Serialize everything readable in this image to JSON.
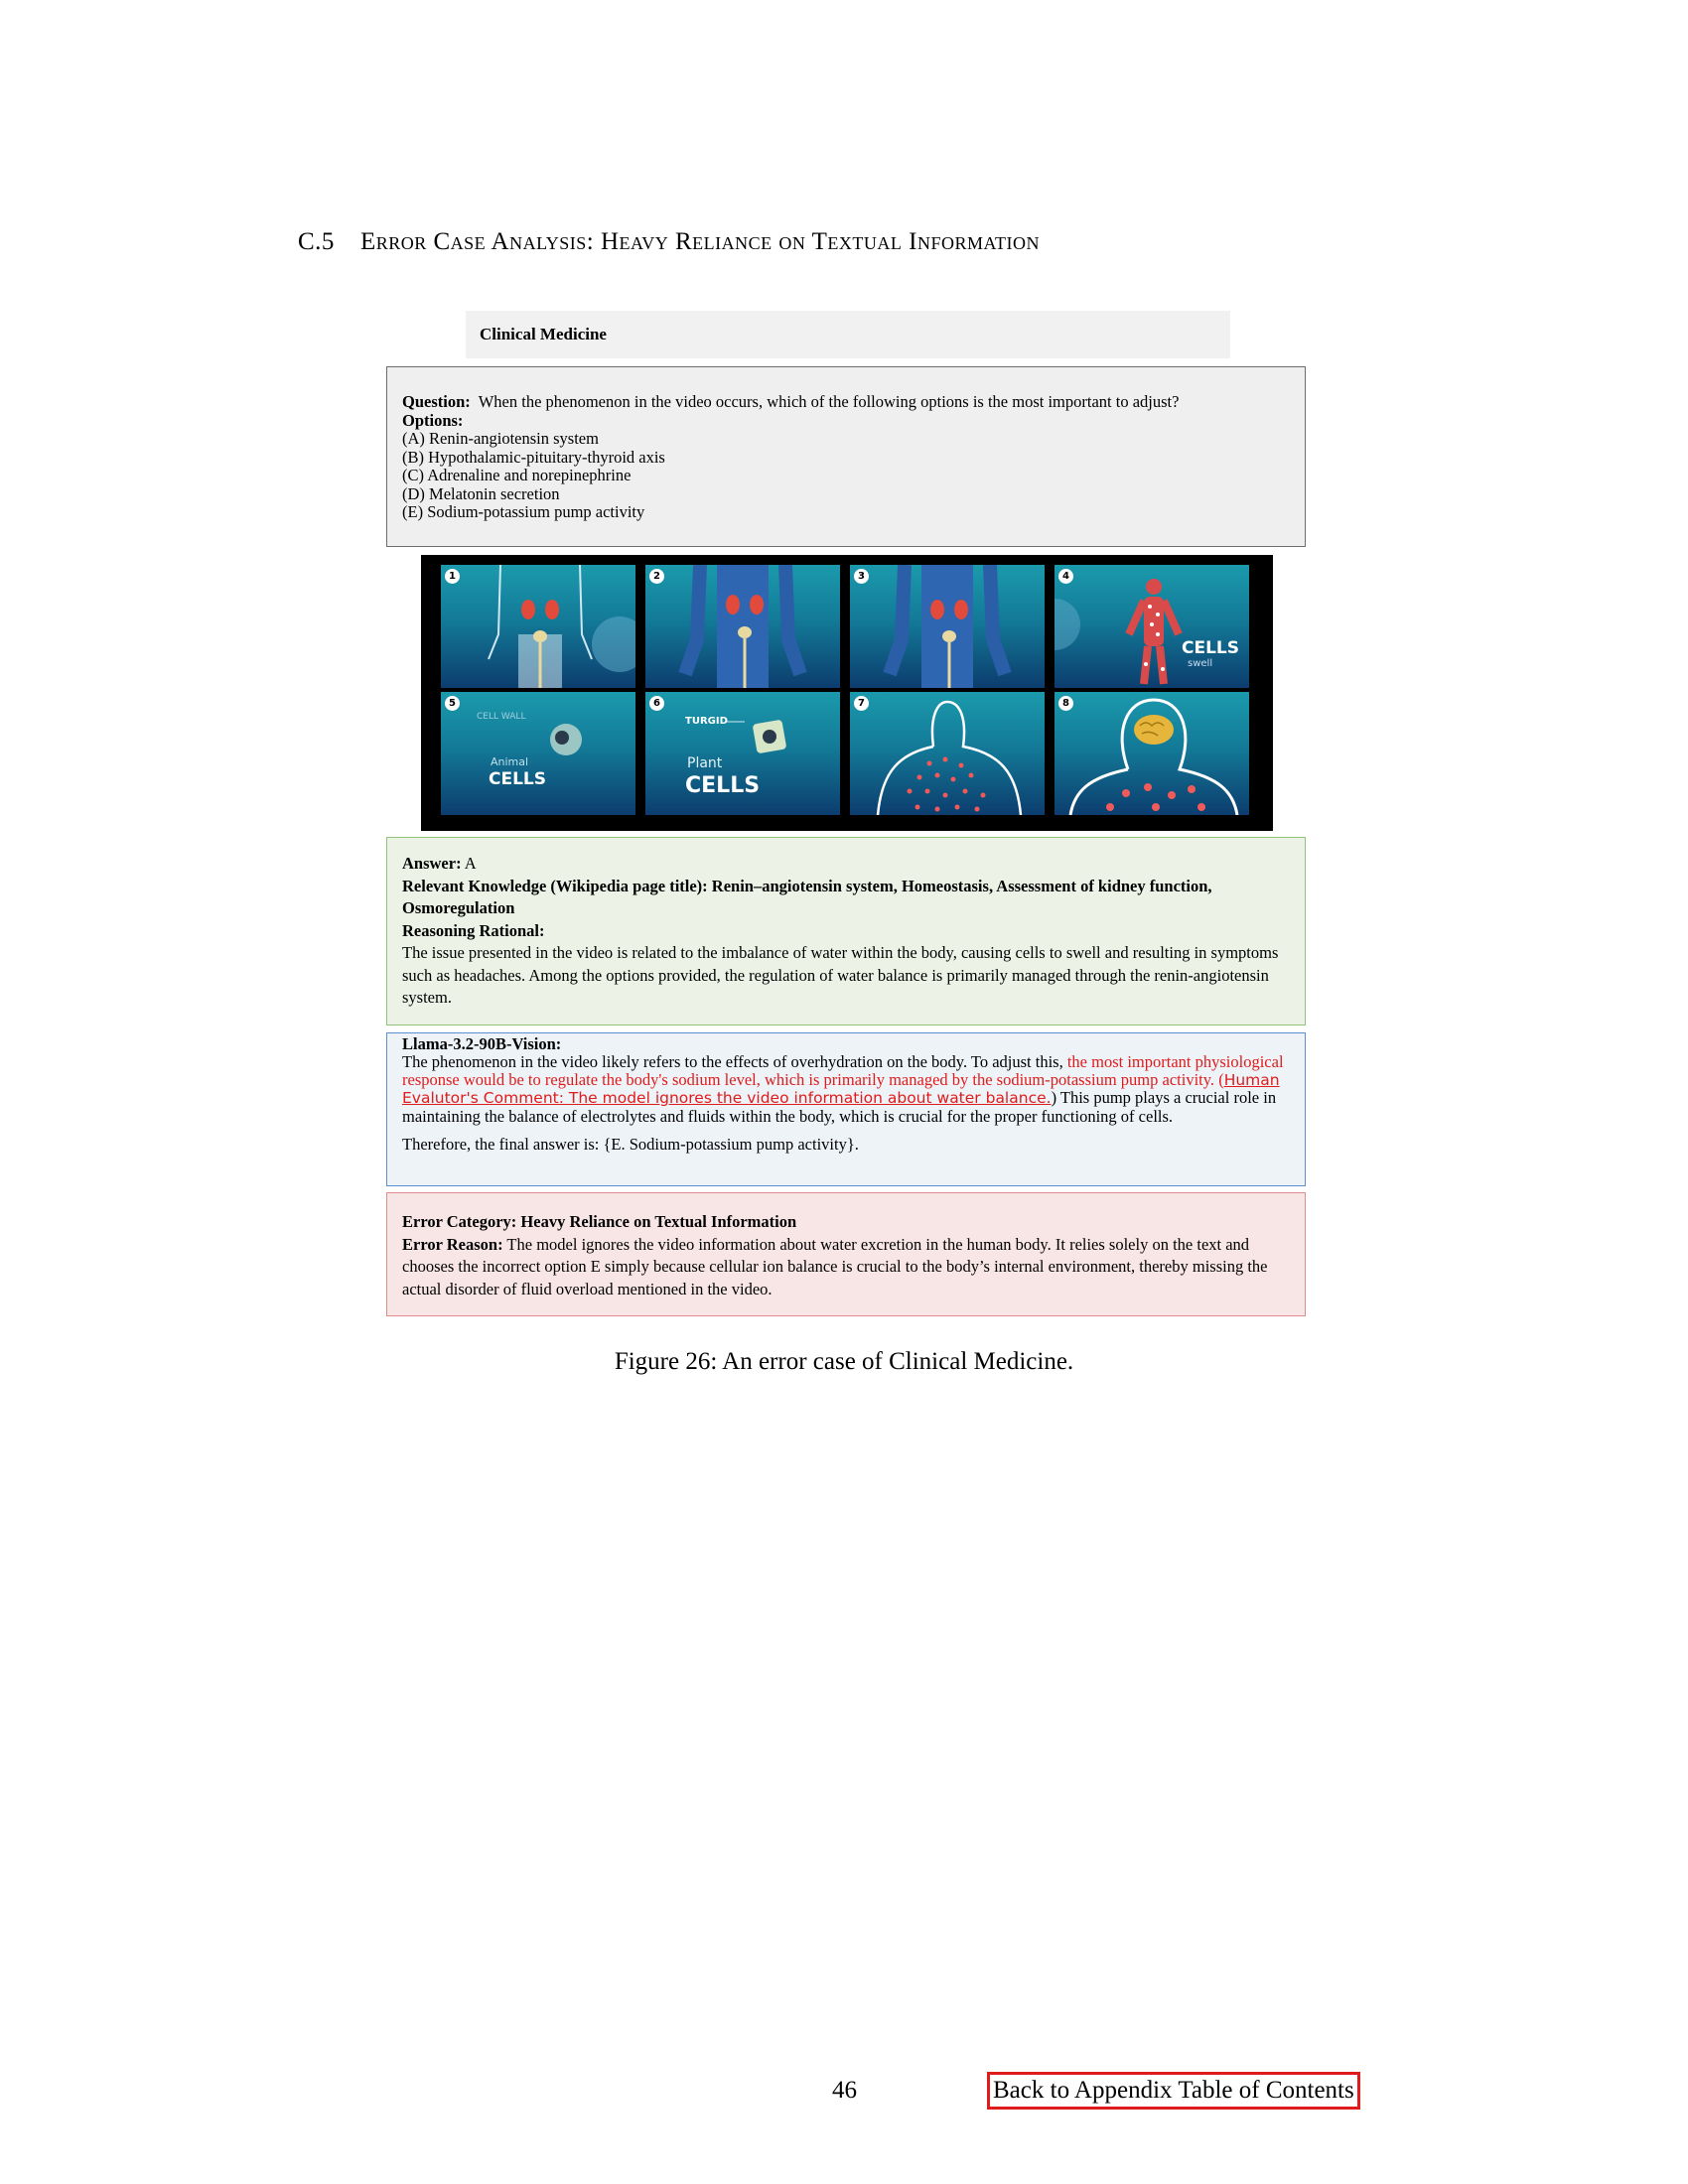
{
  "section": {
    "number": "C.5",
    "title": "Error Case Analysis: Heavy Reliance on Textual Information"
  },
  "subject": "Clinical Medicine",
  "question": {
    "label": "Question:",
    "text": "When the phenomenon in the video occurs, which of the following options is the most important to adjust?",
    "options_label": "Options:",
    "options": [
      "(A) Renin-angiotensin system",
      "(B) Hypothalamic-pituitary-thyroid axis",
      "(C) Adrenaline and norepinephrine",
      "(D) Melatonin secretion",
      "(E) Sodium-potassium pump activity"
    ]
  },
  "frames": [
    {
      "num": "1",
      "text": ""
    },
    {
      "num": "2",
      "text": ""
    },
    {
      "num": "3",
      "text": ""
    },
    {
      "num": "4",
      "text": "CELLS",
      "subtext": "swell"
    },
    {
      "num": "5",
      "text": "CELLS",
      "subtext": "Animal",
      "extra": "CELL WALL"
    },
    {
      "num": "6",
      "text": "CELLS",
      "subtext": "Plant",
      "extra": "TURGID"
    },
    {
      "num": "7",
      "text": ""
    },
    {
      "num": "8",
      "text": ""
    }
  ],
  "answer": {
    "label": "Answer:",
    "value": "A",
    "knowledge_label": "Relevant Knowledge (Wikipedia page title): Renin–angiotensin system, Homeostasis, Assessment of kidney function, Osmoregulation",
    "reasoning_label": "Reasoning Rational:",
    "reasoning_text": "The issue presented in the video is related to the imbalance of water within the body, causing cells to swell and resulting in symptoms such as headaches. Among the options provided, the regulation of water balance is primarily managed through the renin-angiotensin system."
  },
  "model": {
    "name": "Llama-3.2-90B-Vision:",
    "text_before": "The phenomenon in the video likely refers to the effects of overhydration on the body. To adjust this, ",
    "text_red": "the most important physiological response would be to regulate the body's sodium level, which is primarily managed by the sodium-potassium pump activity. ",
    "comment_open": "(",
    "comment": "Human Evalutor's Comment: The model ignores the video information about water balance.",
    "comment_close": ")",
    "text_after": " This pump plays a crucial role in maintaining the balance of electrolytes and fluids within the body, which is crucial for the proper functioning of cells.",
    "final_answer": "Therefore, the final answer is: {E. Sodium-potassium pump activity}."
  },
  "error": {
    "category_label": "Error Category: Heavy Reliance on Textual Information",
    "reason_label": "Error Reason:",
    "reason_text": "The model ignores the video information about water excretion in the human body. It relies solely on the text and chooses the incorrect option E simply because cellular ion balance is crucial to the body’s internal environment, thereby missing the actual disorder of fluid overload mentioned in the video."
  },
  "caption": "Figure 26: An error case of Clinical Medicine.",
  "footer": {
    "page_number": "46",
    "back_link": "Back to Appendix Table of Contents"
  },
  "colors": {
    "highlight_red": "#e01b1b",
    "answer_border": "#8fc47a",
    "model_border": "#5b8fd0",
    "error_border": "#e18b8b"
  }
}
